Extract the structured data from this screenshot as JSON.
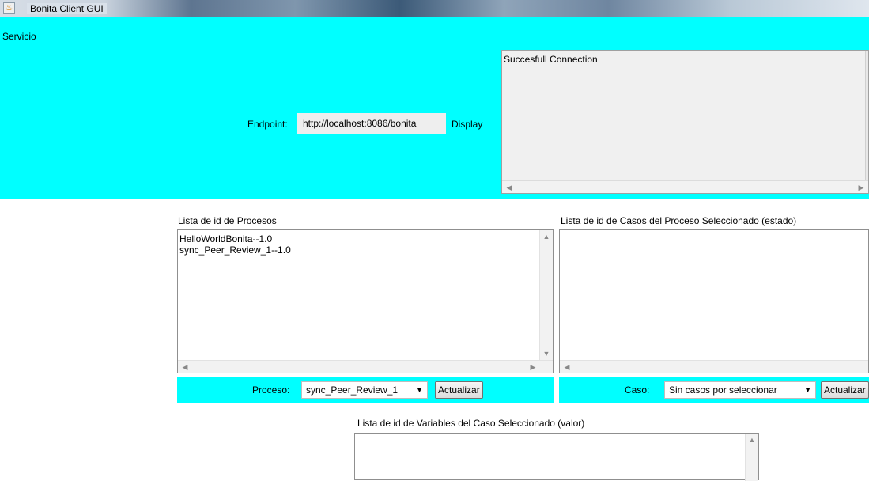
{
  "window": {
    "title": "Bonita Client GUI",
    "icon": "java-cup-icon"
  },
  "menu": {
    "servicio": "Servicio"
  },
  "connection": {
    "endpoint_label": "Endpoint:",
    "endpoint_value": "http://localhost:8086/bonita",
    "display_label": "Display",
    "display_text": "Succesfull Connection"
  },
  "processes": {
    "title": "Lista de id de Procesos",
    "items": [
      "HelloWorldBonita--1.0",
      "sync_Peer_Review_1--1.0"
    ],
    "combo_label": "Proceso:",
    "combo_value": "sync_Peer_Review_1",
    "refresh_label": "Actualizar"
  },
  "cases": {
    "title": "Lista de id de Casos del Proceso Seleccionado (estado)",
    "items": [],
    "combo_label": "Caso:",
    "combo_value": "Sin casos por seleccionar",
    "refresh_label": "Actualizar"
  },
  "variables": {
    "title": "Lista de id de Variables del Caso Seleccionado (valor)"
  },
  "colors": {
    "panel": "#00ffff",
    "background": "#ffffff"
  }
}
